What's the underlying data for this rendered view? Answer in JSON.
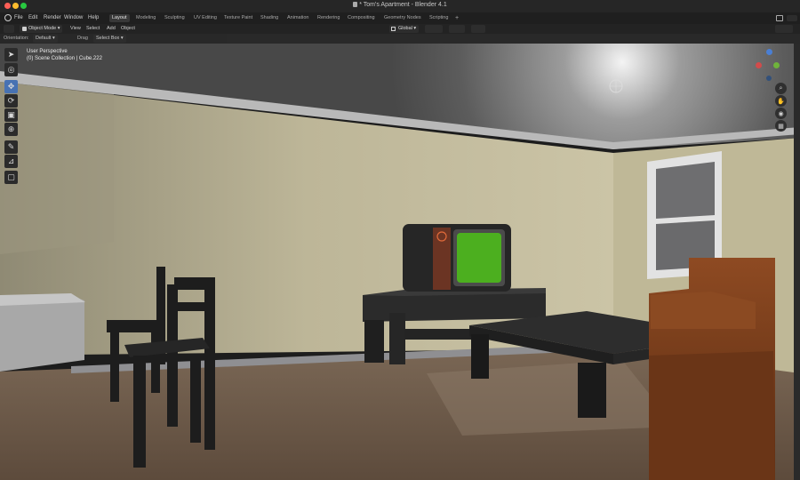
{
  "window": {
    "title": "* Tom's Apartment - Blender 4.1",
    "traffic_lights": [
      "#ff5f57",
      "#febc2e",
      "#28c840"
    ]
  },
  "menu": {
    "file": "File",
    "edit": "Edit",
    "render": "Render",
    "window": "Window",
    "help": "Help"
  },
  "workspaces": [
    {
      "label": "Layout",
      "active": true
    },
    {
      "label": "Modeling"
    },
    {
      "label": "Sculpting"
    },
    {
      "label": "UV Editing"
    },
    {
      "label": "Texture Paint"
    },
    {
      "label": "Shading"
    },
    {
      "label": "Animation"
    },
    {
      "label": "Rendering"
    },
    {
      "label": "Compositing"
    },
    {
      "label": "Geometry Nodes"
    },
    {
      "label": "Scripting"
    },
    {
      "label": "+"
    }
  ],
  "header": {
    "mode": "Object Mode",
    "view": "View",
    "select": "Select",
    "add": "Add",
    "object": "Object",
    "transform_orientation": "Global"
  },
  "tool_settings": {
    "orientation_label": "Orientation:",
    "orientation_value": "Default",
    "drag_label": "Drag",
    "drag_value": "Select Box"
  },
  "viewport": {
    "perspective": "User Perspective",
    "collection": "(0) Scene Collection | Cube.222"
  },
  "gizmo": {
    "x_label": "X",
    "y_label": "Y",
    "z_label": "Z"
  },
  "colors": {
    "accent": "#4772b3",
    "tv_screen": "#4caf1f",
    "wall": "#c9c1a2",
    "floor": "#6e5a49"
  }
}
